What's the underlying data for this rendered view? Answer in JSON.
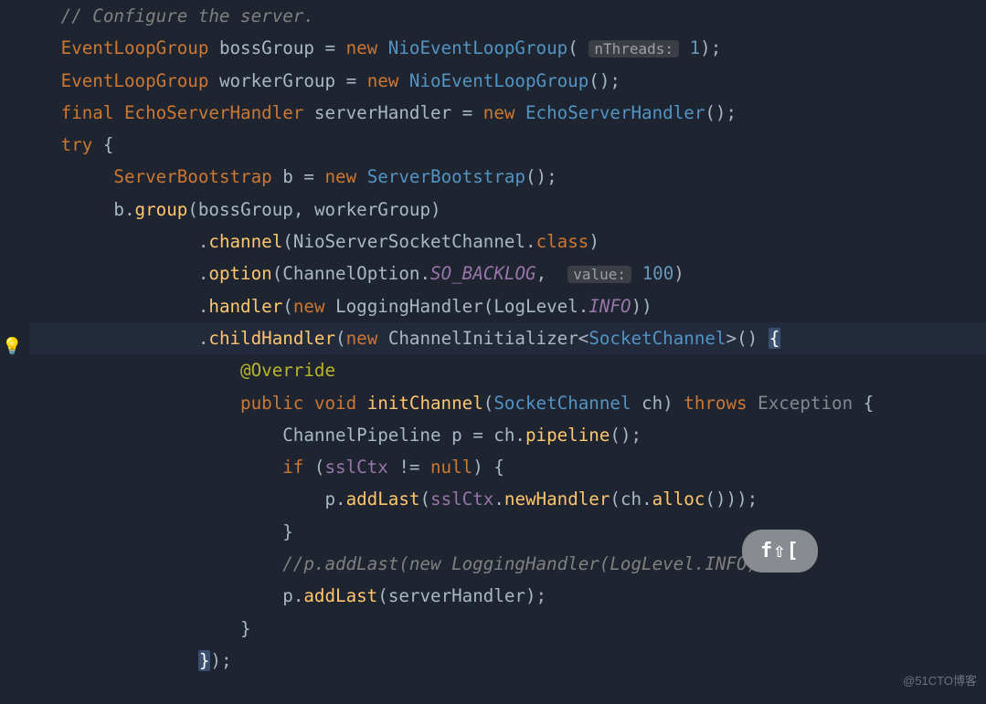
{
  "code": {
    "l1": {
      "comment": "// Configure the server."
    },
    "l2": {
      "type": "EventLoopGroup",
      "var": "bossGroup",
      "eq": " = ",
      "new": "new ",
      "cls": "NioEventLoopGroup",
      "lp": "(",
      "hint": "nThreads:",
      "num": "1",
      "rp": ");"
    },
    "l3": {
      "type": "EventLoopGroup",
      "var": "workerGroup",
      "eq": " = ",
      "new": "new ",
      "cls": "NioEventLoopGroup",
      "par": "();"
    },
    "l4": {
      "final": "final ",
      "type": "EchoServerHandler",
      "var": "serverHandler",
      "eq": " = ",
      "new": "new ",
      "cls": "EchoServerHandler",
      "par": "();"
    },
    "l5": {
      "try": "try ",
      "brace": "{"
    },
    "l6": {
      "type": "ServerBootstrap",
      "var": "b",
      "eq": " = ",
      "new": "new ",
      "cls": "ServerBootstrap",
      "par": "();"
    },
    "l7": {
      "obj": "b",
      "dot": ".",
      "m": "group",
      "lp": "(",
      "a1": "bossGroup",
      "comma": ", ",
      "a2": "workerGroup",
      "rp": ")"
    },
    "l8": {
      "dot": ".",
      "m": "channel",
      "lp": "(",
      "arg": "NioServerSocketChannel",
      "dot2": ".",
      "cls": "class",
      "rp": ")"
    },
    "l9": {
      "dot": ".",
      "m": "option",
      "lp": "(",
      "arg": "ChannelOption",
      "dot2": ".",
      "fld": "SO_BACKLOG",
      "comma": ", ",
      "hint": "value:",
      "num": "100",
      "rp": ")"
    },
    "l10": {
      "dot": ".",
      "m": "handler",
      "lp": "(",
      "new": "new ",
      "cls": "LoggingHandler",
      "lp2": "(",
      "arg": "LogLevel",
      "dot2": ".",
      "fld": "INFO",
      "rp": "))"
    },
    "l11": {
      "dot": ".",
      "m": "childHandler",
      "lp": "(",
      "new": "new ",
      "cls": "ChannelInitializer",
      "lt": "<",
      "gen": "SocketChannel",
      "gt": ">",
      "par": "() ",
      "brace": "{"
    },
    "l12": {
      "ann": "@Override"
    },
    "l13": {
      "pub": "public ",
      "void": "void ",
      "m": "initChannel",
      "lp": "(",
      "type": "SocketChannel",
      "var": " ch",
      "rp": ") ",
      "throws": "throws ",
      "exc": "Exception ",
      "brace": "{"
    },
    "l14": {
      "type": "ChannelPipeline",
      "var": " p",
      "eq": " = ",
      "obj": "ch",
      "dot": ".",
      "m": "pipeline",
      "par": "();"
    },
    "l15": {
      "if": "if ",
      "lp": "(",
      "var": "sslCtx",
      "op": " != ",
      "null": "null",
      "rp": ") ",
      "brace": "{"
    },
    "l16": {
      "obj": "p",
      "dot": ".",
      "m": "addLast",
      "lp": "(",
      "var": "sslCtx",
      "dot2": ".",
      "m2": "newHandler",
      "lp2": "(",
      "obj2": "ch",
      "dot3": ".",
      "m3": "alloc",
      "par": "()));"
    },
    "l17": {
      "brace": "}"
    },
    "l18": {
      "comment": "//p.addLast(new LoggingHandler(LogLevel.INFO));"
    },
    "l19": {
      "obj": "p",
      "dot": ".",
      "m": "addLast",
      "lp": "(",
      "var": "serverHandler",
      "rp": ");"
    },
    "l20": {
      "brace": "}"
    },
    "l21": {
      "brace": "}",
      "rp": ");"
    },
    "hint_sp": " "
  },
  "bulb_icon": "💡",
  "keycap": "f⇧[",
  "watermark": "@51CTO博客"
}
